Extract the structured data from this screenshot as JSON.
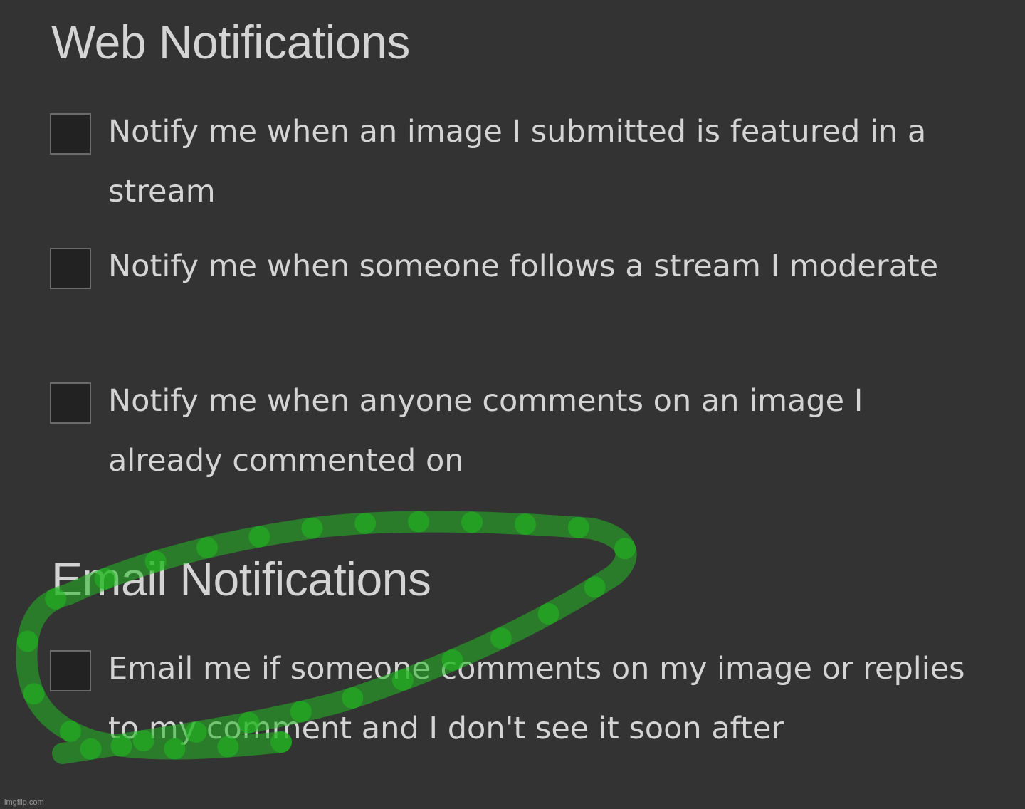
{
  "web_section": {
    "title": "Web Notifications",
    "options": [
      {
        "label": "Notify me when an image I submitted is featured in a stream",
        "checked": false
      },
      {
        "label": "Notify me when someone follows a stream I moderate",
        "checked": false
      },
      {
        "label": "Notify me when anyone comments on an image I already commented on",
        "checked": false
      }
    ]
  },
  "email_section": {
    "title": "Email Notifications",
    "options": [
      {
        "label": "Email me if someone comments on my image or replies to my comment and I don't see it soon after",
        "checked": false
      }
    ]
  },
  "annotation": {
    "type": "hand-drawn loop",
    "color": "#22b822"
  },
  "watermark": "imgflip.com",
  "colors": {
    "background": "#333333",
    "text": "#d4d4d4",
    "checkbox_fill": "#222222",
    "checkbox_border": "#6b6b6b"
  }
}
